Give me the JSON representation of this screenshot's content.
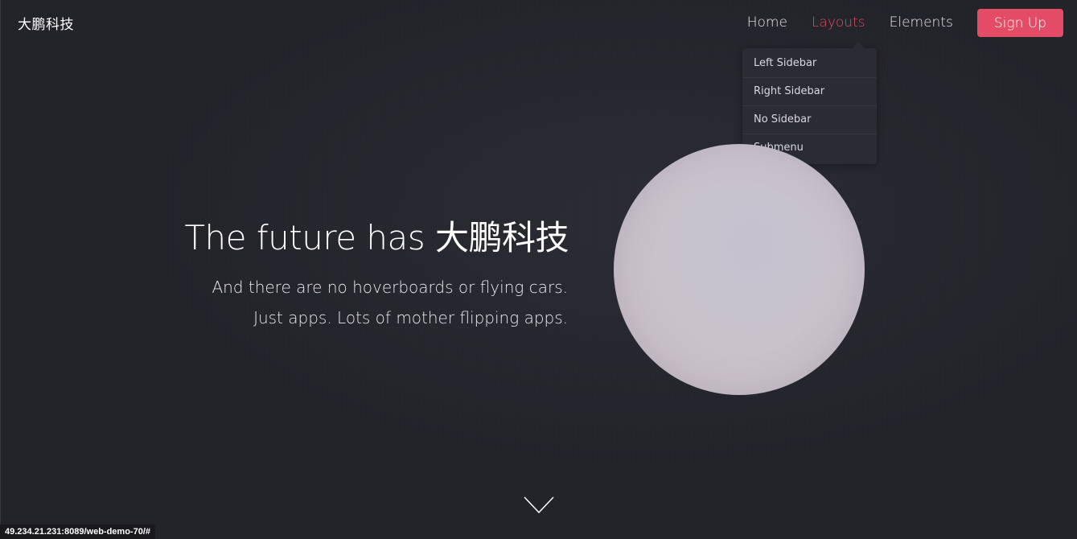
{
  "header": {
    "brand": "大鹏科技",
    "nav": [
      {
        "label": "Home"
      },
      {
        "label": "Layouts",
        "active": true
      },
      {
        "label": "Elements"
      }
    ],
    "signup_label": "Sign Up"
  },
  "dropdown": {
    "items": [
      {
        "label": "Left Sidebar"
      },
      {
        "label": "Right Sidebar"
      },
      {
        "label": "No Sidebar"
      },
      {
        "label": "Submenu"
      }
    ]
  },
  "hero": {
    "title": "The future has 大鹏科技",
    "subtitle_line1": "And there are no hoverboards or flying cars.",
    "subtitle_line2": "Just apps. Lots of mother flipping apps."
  },
  "scroll_icon": "chevron-down-icon",
  "status_url": "49.234.21.231:8089/web-demo-70/#",
  "colors": {
    "accent": "#e44c65",
    "background": "#23232b",
    "dropdown_bg": "#2b2b33"
  }
}
